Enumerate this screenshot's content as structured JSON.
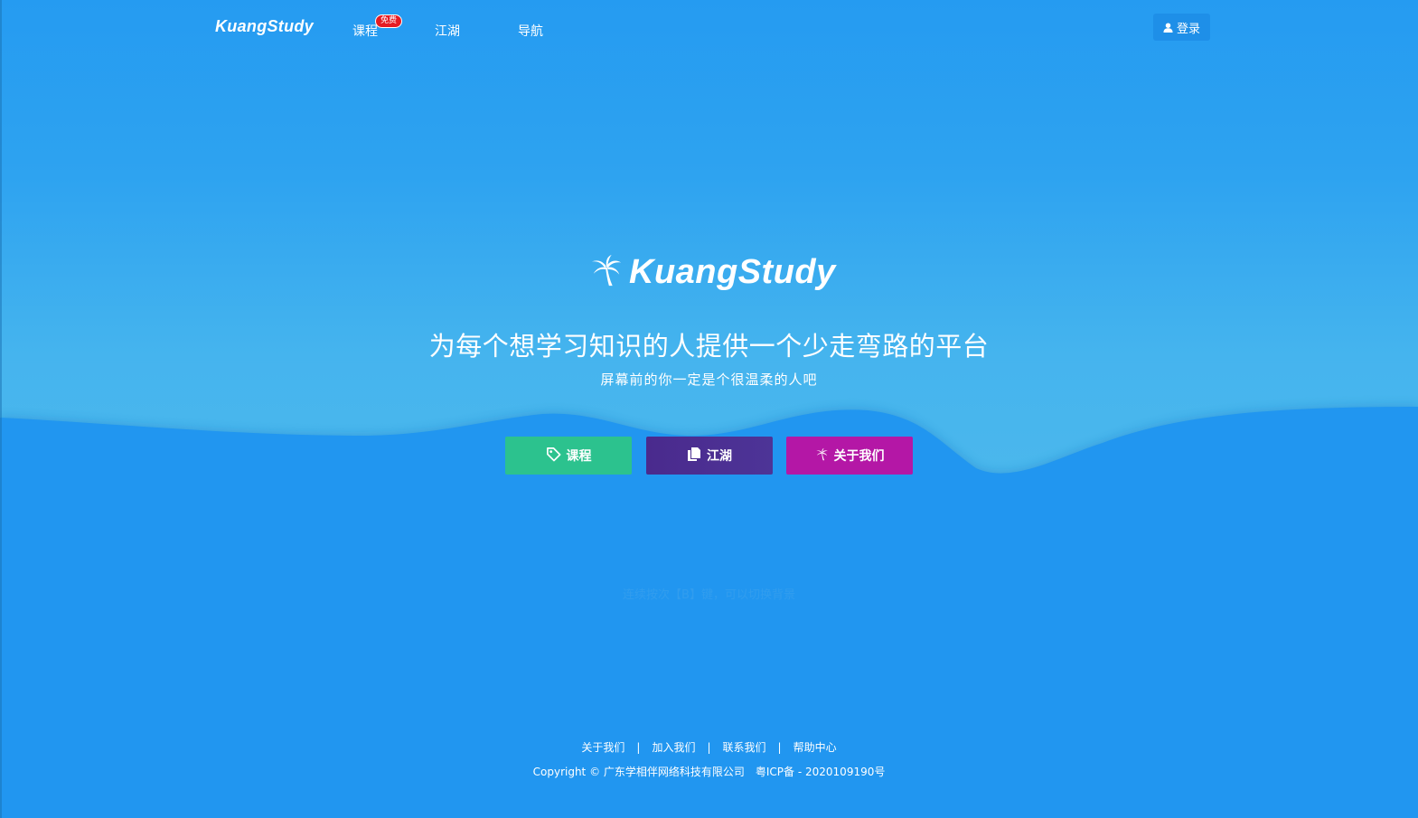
{
  "colors": {
    "page_bg": "#2196f0",
    "hero_bg_bottom": "#4cb8ec",
    "badge_red": "#e51b23",
    "btn_course": "#2cc28e",
    "btn_jianghu": "#4a2a8d",
    "btn_about": "#b417a6"
  },
  "nav": {
    "brand": "KuangStudy",
    "items": [
      {
        "label": "课程",
        "badge": "免费"
      },
      {
        "label": "江湖"
      },
      {
        "label": "导航"
      }
    ],
    "login": {
      "icon": "user-icon",
      "label": "登录"
    }
  },
  "hero": {
    "logo_icon": "palm-tree-icon",
    "logo_text": "KuangStudy",
    "headline": "为每个想学习知识的人提供一个少走弯路的平台",
    "subline": "屏幕前的你一定是个很温柔的人吧"
  },
  "actions": [
    {
      "icon": "tag-icon",
      "label": "课程"
    },
    {
      "icon": "copy-icon",
      "label": "江湖"
    },
    {
      "icon": "palm-tree-icon",
      "label": "关于我们"
    }
  ],
  "hint": "连续按次【B】键，可以切换背景",
  "footer": {
    "links": [
      "关于我们",
      "加入我们",
      "联系我们",
      "帮助中心"
    ],
    "separator": "|",
    "copyright": "Copyright © 广东学相伴网络科技有限公司",
    "icp": "粤ICP备 - 2020109190号"
  }
}
